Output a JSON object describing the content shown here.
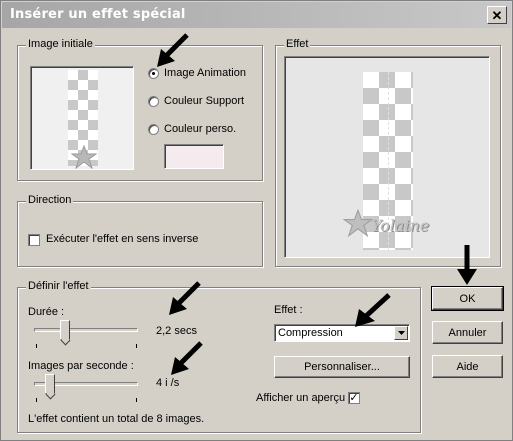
{
  "window": {
    "title": "Insérer un effet spécial",
    "close_glyph": "✕"
  },
  "image_initiale": {
    "legend": "Image initiale",
    "options": [
      {
        "label": "Image Animation",
        "selected": true
      },
      {
        "label": "Couleur Support",
        "selected": false
      },
      {
        "label": "Couleur perso.",
        "selected": false
      }
    ],
    "custom_color": "#f5ebef"
  },
  "direction": {
    "legend": "Direction",
    "reverse_label": "Exécuter l'effet en sens inverse",
    "reverse_checked": false
  },
  "effet_preview": {
    "legend": "Effet",
    "watermark": "Yolaine"
  },
  "definir": {
    "legend": "Définir l'effet",
    "duree_label": "Durée :",
    "duree_value": "2,2 secs",
    "duree_level": 0.28,
    "fps_label": "Images par seconde :",
    "fps_value": "4 i /s",
    "fps_level": 0.12,
    "effet_label": "Effet :",
    "effet_value": "Compression",
    "personnaliser_label": "Personnaliser...",
    "apercu_label": "Afficher un aperçu",
    "apercu_checked": true,
    "total_text": "L'effet contient un total de 8 images."
  },
  "buttons": {
    "ok": "OK",
    "annuler": "Annuler",
    "aide": "Aide"
  },
  "colors": {
    "face": "#d4d0c8",
    "titlebar": "#a6a6a6",
    "arrow": "#000000"
  }
}
